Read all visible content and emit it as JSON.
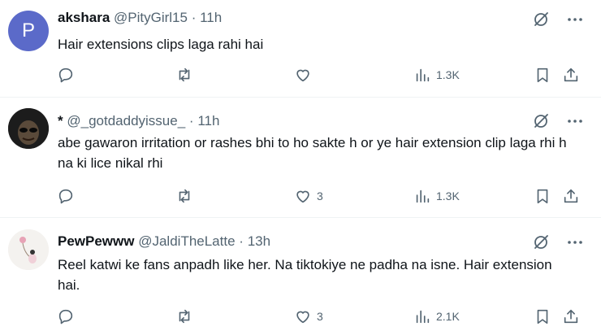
{
  "tweets": [
    {
      "name": "akshara",
      "handle": "@PityGirl15",
      "time": "11h",
      "avatar_letter": "P",
      "avatar_color": "#5b6ac9",
      "text": "Hair extensions clips laga rahi  hai",
      "likes": "",
      "views": "1.3K"
    },
    {
      "name": "*",
      "handle": "@_gotdaddyissue_",
      "time": "11h",
      "text": "abe gawaron irritation or rashes bhi to ho sakte h or ye hair extension clip laga rhi h na ki lice nikal rhi",
      "likes": "3",
      "views": "1.3K"
    },
    {
      "name": "PewPewww",
      "handle": "@JaldiTheLatte",
      "time": "13h",
      "text": "Reel katwi ke fans anpadh like her. Na tiktokiye ne padha na isne. Hair extension hai.",
      "likes": "3",
      "views": "2.1K"
    }
  ],
  "separator": "·",
  "colors": {
    "text": "#0f1419",
    "secondary": "#536471",
    "divider": "#eff3f4"
  },
  "icons": [
    "grok-icon",
    "more-icon",
    "reply-icon",
    "retweet-icon",
    "like-icon",
    "views-icon",
    "bookmark-icon",
    "share-icon"
  ]
}
